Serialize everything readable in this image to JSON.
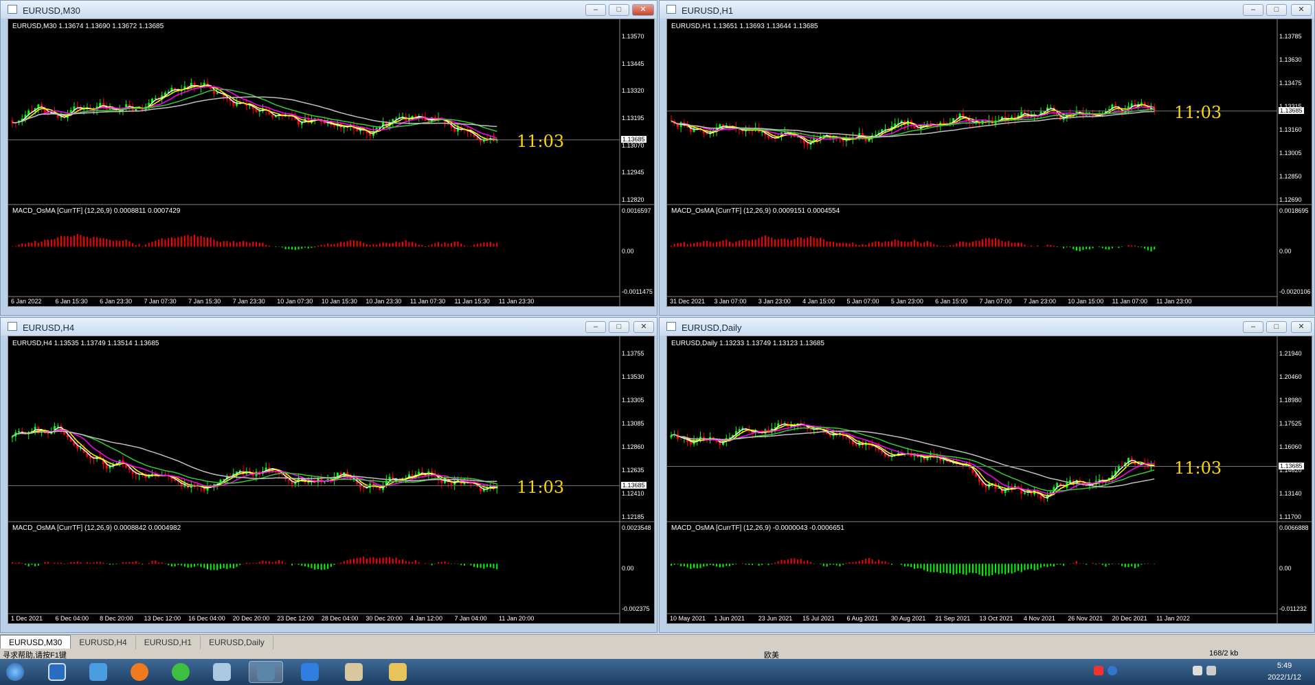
{
  "windows": [
    {
      "title": "EURUSD,M30",
      "symbol_line": "EURUSD,M30  1.13674 1.13690 1.13672 1.13685",
      "macd_line": "MACD_OsMA [CurrTF] (12,26,9) 0.0008811 0.0007429",
      "time": "11:03",
      "current_price": "1.13685",
      "price_labels": [
        "1.13570",
        "1.13445",
        "1.13320",
        "1.13195",
        "1.13070",
        "1.12945",
        "1.12820"
      ],
      "macd_labels": [
        "0.0016597",
        "0.00",
        "-0.0011475"
      ],
      "dates": [
        "6 Jan 2022",
        "6 Jan 15:30",
        "6 Jan 23:30",
        "7 Jan 07:30",
        "7 Jan 15:30",
        "7 Jan 23:30",
        "10 Jan 07:30",
        "10 Jan 15:30",
        "10 Jan 23:30",
        "11 Jan 07:30",
        "11 Jan 15:30",
        "11 Jan 23:30"
      ],
      "buttons": [
        "minimize",
        "maximize",
        "close"
      ]
    },
    {
      "title": "EURUSD,H1",
      "symbol_line": "EURUSD,H1  1.13651 1.13693 1.13644 1.13685",
      "macd_line": "MACD_OsMA [CurrTF] (12,26,9) 0.0009151 0.0004554",
      "time": "11:03",
      "current_price": "1.13685",
      "price_labels": [
        "1.13785",
        "1.13630",
        "1.13475",
        "1.13315",
        "1.13160",
        "1.13005",
        "1.12850",
        "1.12690"
      ],
      "macd_labels": [
        "0.0018695",
        "0.00",
        "-0.0020106"
      ],
      "dates": [
        "31 Dec 2021",
        "3 Jan 07:00",
        "3 Jan 23:00",
        "4 Jan 15:00",
        "5 Jan 07:00",
        "5 Jan 23:00",
        "6 Jan 15:00",
        "7 Jan 07:00",
        "7 Jan 23:00",
        "10 Jan 15:00",
        "11 Jan 07:00",
        "11 Jan 23:00"
      ],
      "buttons": [
        "minimize",
        "maximize",
        "close"
      ]
    },
    {
      "title": "EURUSD,H4",
      "symbol_line": "EURUSD,H4  1.13535 1.13749 1.13514 1.13685",
      "macd_line": "MACD_OsMA [CurrTF] (12,26,9) 0.0008842 0.0004982",
      "time": "11:03",
      "current_price": "1.13685",
      "price_labels": [
        "1.13755",
        "1.13530",
        "1.13305",
        "1.13085",
        "1.12860",
        "1.12635",
        "1.12410",
        "1.12185"
      ],
      "macd_labels": [
        "0.0023548",
        "0.00",
        "-0.002375"
      ],
      "dates": [
        "1 Dec 2021",
        "6 Dec 04:00",
        "8 Dec 20:00",
        "13 Dec 12:00",
        "16 Dec 04:00",
        "20 Dec 20:00",
        "23 Dec 12:00",
        "28 Dec 04:00",
        "30 Dec 20:00",
        "4 Jan 12:00",
        "7 Jan 04:00",
        "11 Jan 20:00"
      ],
      "buttons": [
        "minimize",
        "maximize",
        "close"
      ]
    },
    {
      "title": "EURUSD,Daily",
      "symbol_line": "EURUSD,Daily  1.13233 1.13749 1.13123 1.13685",
      "macd_line": "MACD_OsMA [CurrTF] (12,26,9) -0.0000043 -0.0006651",
      "time": "11:03",
      "current_price": "1.13685",
      "price_labels": [
        "1.21940",
        "1.20460",
        "1.18980",
        "1.17525",
        "1.16060",
        "1.14620",
        "1.13140",
        "1.11700"
      ],
      "macd_labels": [
        "0.0066888",
        "0.00",
        "-0.011232"
      ],
      "dates": [
        "10 May 2021",
        "1 Jun 2021",
        "23 Jun 2021",
        "15 Jul 2021",
        "6 Aug 2021",
        "30 Aug 2021",
        "21 Sep 2021",
        "13 Oct 2021",
        "4 Nov 2021",
        "26 Nov 2021",
        "20 Dec 2021",
        "11 Jan 2022"
      ],
      "buttons": [
        "minimize",
        "maximize",
        "close"
      ]
    }
  ],
  "tabs": [
    "EURUSD,M30",
    "EURUSD,H4",
    "EURUSD,H1",
    "EURUSD,Daily"
  ],
  "status": {
    "help": "寻求帮助,请按F1键",
    "profile": "欧美",
    "traffic": "168/2 kb"
  },
  "clock": {
    "time": "5:49",
    "date": "2022/1/12"
  },
  "colors": {
    "bull": "#00ff00",
    "bear": "#ff0000",
    "ma_white": "#ffffff",
    "ma_yellow": "#ffff00",
    "ma_magenta": "#ff00ff",
    "ma_green": "#32cd32",
    "ma_gray": "#c0c0c0",
    "time_label": "#ffd700"
  }
}
